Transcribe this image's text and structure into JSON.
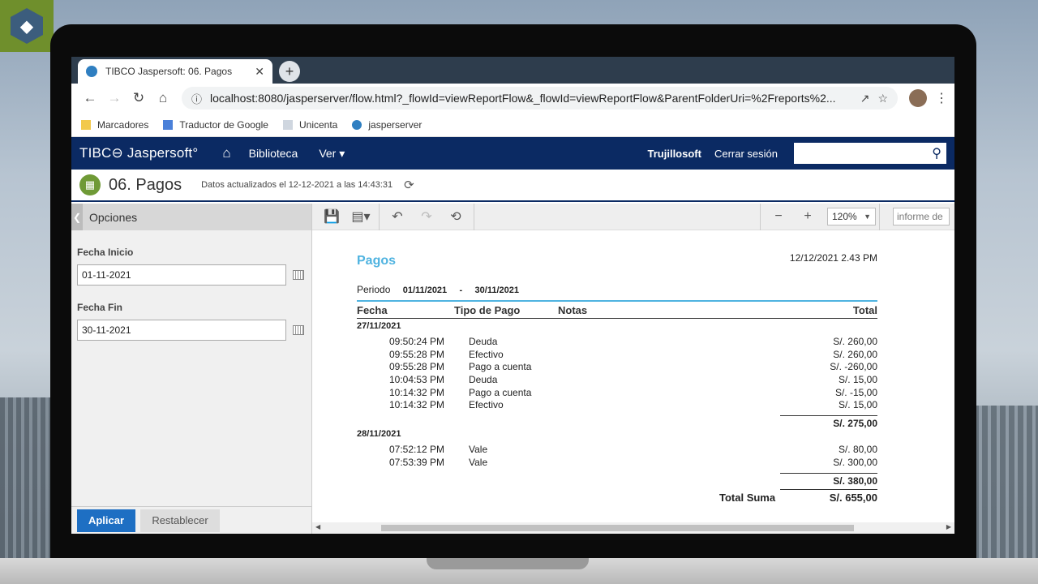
{
  "browser": {
    "tab_title": "TIBCO Jaspersoft: 06. Pagos",
    "url": "localhost:8080/jasperserver/flow.html?_flowId=viewReportFlow&_flowId=viewReportFlow&ParentFolderUri=%2Freports%2...",
    "bookmarks": [
      "Marcadores",
      "Traductor de Google",
      "Unicenta",
      "jasperserver"
    ]
  },
  "header": {
    "logo": "TIBC⊖ Jaspersoft°",
    "nav": [
      "Biblioteca",
      "Ver ▾"
    ],
    "user": "Trujillosoft",
    "logout": "Cerrar sesión"
  },
  "report_title": {
    "name": "06. Pagos",
    "updated": "Datos actualizados el 12-12-2021 a las 14:43:31"
  },
  "options": {
    "heading": "Opciones",
    "fecha_inicio_label": "Fecha Inicio",
    "fecha_inicio_value": "01-11-2021",
    "fecha_fin_label": "Fecha Fin",
    "fecha_fin_value": "30-11-2021",
    "apply": "Aplicar",
    "reset": "Restablecer"
  },
  "viewer": {
    "zoom": "120%",
    "search_placeholder": "informe de"
  },
  "report": {
    "title": "Pagos",
    "generated": "12/12/2021 2.43 PM",
    "period_label": "Periodo",
    "period_from": "01/11/2021",
    "period_sep": "-",
    "period_to": "30/11/2021",
    "columns": {
      "fecha": "Fecha",
      "tipo": "Tipo de Pago",
      "notas": "Notas",
      "total": "Total"
    },
    "groups": [
      {
        "date": "27/11/2021",
        "rows": [
          {
            "time": "09:50:24 PM",
            "tipo": "Deuda",
            "total": "S/. 260,00"
          },
          {
            "time": "09:55:28 PM",
            "tipo": "Efectivo",
            "total": "S/. 260,00"
          },
          {
            "time": "09:55:28 PM",
            "tipo": "Pago a cuenta",
            "total": "S/. -260,00"
          },
          {
            "time": "10:04:53 PM",
            "tipo": "Deuda",
            "total": "S/. 15,00"
          },
          {
            "time": "10:14:32 PM",
            "tipo": "Pago a cuenta",
            "total": "S/. -15,00"
          },
          {
            "time": "10:14:32 PM",
            "tipo": "Efectivo",
            "total": "S/. 15,00"
          }
        ],
        "subtotal": "S/. 275,00"
      },
      {
        "date": "28/11/2021",
        "rows": [
          {
            "time": "07:52:12 PM",
            "tipo": "Vale",
            "total": "S/. 80,00"
          },
          {
            "time": "07:53:39 PM",
            "tipo": "Vale",
            "total": "S/. 300,00"
          }
        ],
        "subtotal": "S/. 380,00"
      }
    ],
    "total_label": "Total Suma",
    "total_value": "S/. 655,00"
  }
}
